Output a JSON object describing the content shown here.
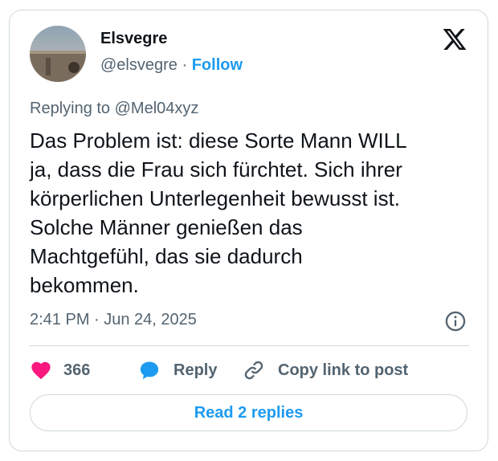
{
  "author": {
    "name": "Elsvegre",
    "handle": "@elsvegre",
    "separator": "·",
    "follow_label": "Follow"
  },
  "icons": {
    "logo": "x-logo-icon",
    "info": "info-icon",
    "like": "heart-icon",
    "reply": "speech-bubble-icon",
    "copy": "link-icon"
  },
  "colors": {
    "accent": "#1d9bf0",
    "like": "#f91880",
    "muted": "#536471",
    "text": "#0f1419",
    "border": "#cfd9de"
  },
  "tweet": {
    "replying_to": "Replying to @Mel04xyz",
    "text": "Das Problem ist: diese Sorte Mann WILL\nja, dass die Frau sich fürchtet. Sich ihrer\nkörperlichen Unterlegenheit bewusst ist.\nSolche Männer genießen das\nMachtgefühl, das sie dadurch\nbekommen.",
    "timestamp": "2:41 PM · Jun 24, 2025"
  },
  "actions": {
    "like_count": "366",
    "reply_label": "Reply",
    "copy_label": "Copy link to post"
  },
  "read_replies_label": "Read 2 replies"
}
